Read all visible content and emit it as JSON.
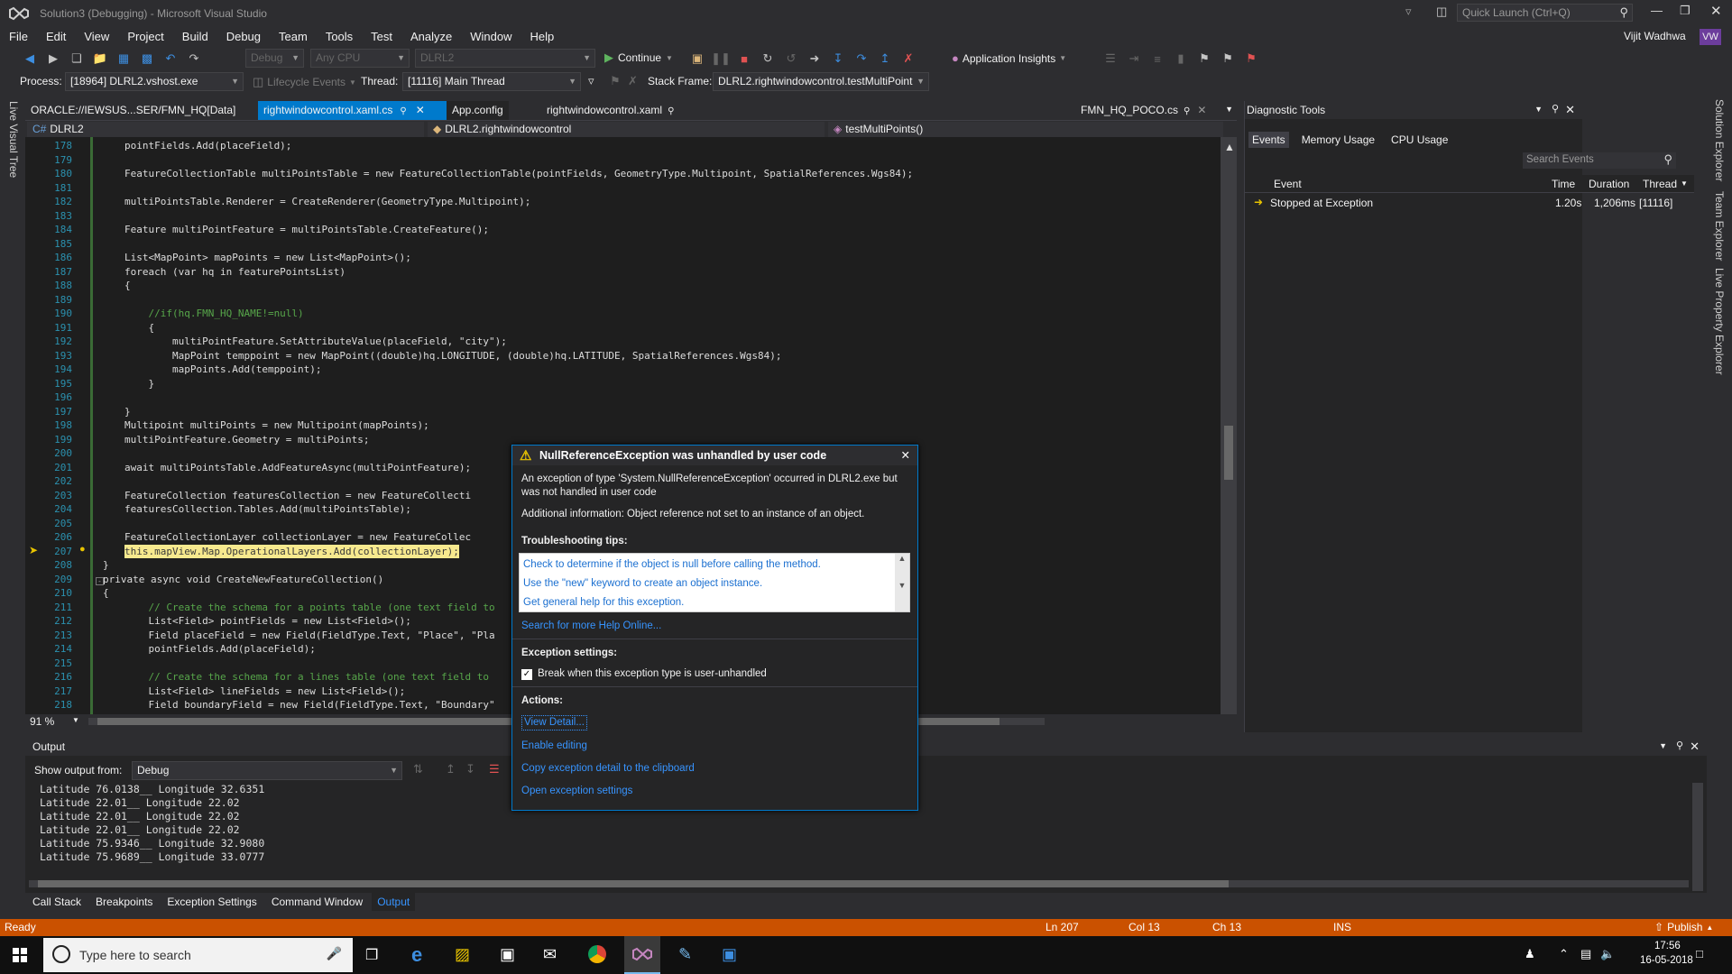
{
  "title": {
    "text": "Solution3 (Debugging) - Microsoft Visual Studio",
    "quick_launch": "Quick Launch (Ctrl+Q)"
  },
  "menu": [
    "File",
    "Edit",
    "View",
    "Project",
    "Build",
    "Debug",
    "Team",
    "Tools",
    "Test",
    "Analyze",
    "Window",
    "Help"
  ],
  "user": {
    "name": "Vijit Wadhwa",
    "initials": "VW"
  },
  "toolbar": {
    "config": "Debug",
    "platform": "Any CPU",
    "project": "DLRL2",
    "continue": "Continue",
    "insights": "Application Insights"
  },
  "debugbar": {
    "process_label": "Process:",
    "process": "[18964] DLRL2.vshost.exe",
    "lifecycle": "Lifecycle Events",
    "thread_label": "Thread:",
    "thread": "[11116] Main Thread",
    "frame_label": "Stack Frame:",
    "frame": "DLRL2.rightwindowcontrol.testMultiPoint"
  },
  "left_vtab": "Live Visual Tree",
  "right_vtabs": [
    "Solution Explorer",
    "Team Explorer",
    "Live Property Explorer"
  ],
  "doc_tabs": {
    "oracle": "ORACLE://IEWSUS...SER/FMN_HQ[Data]",
    "active": "rightwindowcontrol.xaml.cs",
    "appconfig": "App.config",
    "xaml": "rightwindowcontrol.xaml",
    "poco": "FMN_HQ_POCO.cs"
  },
  "nav": {
    "project": "DLRL2",
    "class": "DLRL2.rightwindowcontrol",
    "member": "testMultiPoints()"
  },
  "zoom": "91 %",
  "code_lines": [
    {
      "n": "178",
      "t": "pointFields.Add(placeField);"
    },
    {
      "n": "179",
      "t": ""
    },
    {
      "n": "180",
      "t": "FeatureCollectionTable multiPointsTable = new FeatureCollectionTable(pointFields, GeometryType.Multipoint, SpatialReferences.Wgs84);"
    },
    {
      "n": "181",
      "t": ""
    },
    {
      "n": "182",
      "t": "multiPointsTable.Renderer = CreateRenderer(GeometryType.Multipoint);"
    },
    {
      "n": "183",
      "t": ""
    },
    {
      "n": "184",
      "t": "Feature multiPointFeature = multiPointsTable.CreateFeature();"
    },
    {
      "n": "185",
      "t": ""
    },
    {
      "n": "186",
      "t": "List<MapPoint> mapPoints = new List<MapPoint>();"
    },
    {
      "n": "187",
      "t": "foreach (var hq in featurePointsList)"
    },
    {
      "n": "188",
      "t": "{"
    },
    {
      "n": "189",
      "t": ""
    },
    {
      "n": "190",
      "t": "    //if(hq.FMN_HQ_NAME!=null)"
    },
    {
      "n": "191",
      "t": "    {"
    },
    {
      "n": "192",
      "t": "        multiPointFeature.SetAttributeValue(placeField, \"city\");"
    },
    {
      "n": "193",
      "t": "        MapPoint temppoint = new MapPoint((double)hq.LONGITUDE, (double)hq.LATITUDE, SpatialReferences.Wgs84);"
    },
    {
      "n": "194",
      "t": "        mapPoints.Add(temppoint);"
    },
    {
      "n": "195",
      "t": "    }"
    },
    {
      "n": "196",
      "t": ""
    },
    {
      "n": "197",
      "t": "}"
    },
    {
      "n": "198",
      "t": "Multipoint multiPoints = new Multipoint(mapPoints);"
    },
    {
      "n": "199",
      "t": "multiPointFeature.Geometry = multiPoints;"
    },
    {
      "n": "200",
      "t": ""
    },
    {
      "n": "201",
      "t": "await multiPointsTable.AddFeatureAsync(multiPointFeature);"
    },
    {
      "n": "202",
      "t": ""
    },
    {
      "n": "203",
      "t": "FeatureCollection featuresCollection = new FeatureCollecti"
    },
    {
      "n": "204",
      "t": "featuresCollection.Tables.Add(multiPointsTable);"
    },
    {
      "n": "205",
      "t": ""
    },
    {
      "n": "206",
      "t": "FeatureCollectionLayer collectionLayer = new FeatureCollec"
    },
    {
      "n": "207",
      "t": "this.mapView.Map.OperationalLayers.Add(collectionLayer);"
    },
    {
      "n": "208",
      "t": "}"
    },
    {
      "n": "209",
      "t": "private async void CreateNewFeatureCollection()"
    },
    {
      "n": "210",
      "t": "{"
    },
    {
      "n": "211",
      "t": "    // Create the schema for a points table (one text field to"
    },
    {
      "n": "212",
      "t": "    List<Field> pointFields = new List<Field>();"
    },
    {
      "n": "213",
      "t": "    Field placeField = new Field(FieldType.Text, \"Place\", \"Pla"
    },
    {
      "n": "214",
      "t": "    pointFields.Add(placeField);"
    },
    {
      "n": "215",
      "t": ""
    },
    {
      "n": "216",
      "t": "    // Create the schema for a lines table (one text field to"
    },
    {
      "n": "217",
      "t": "    List<Field> lineFields = new List<Field>();"
    },
    {
      "n": "218",
      "t": "    Field boundaryField = new Field(FieldType.Text, \"Boundary\""
    }
  ],
  "diagnostic": {
    "title": "Diagnostic Tools",
    "tabs": [
      "Events",
      "Memory Usage",
      "CPU Usage"
    ],
    "search": "Search Events",
    "cols": [
      "Event",
      "Time",
      "Duration",
      "Thread"
    ],
    "row": {
      "event": "Stopped at Exception",
      "time": "1.20s",
      "duration": "1,206ms",
      "thread": "[11116]"
    }
  },
  "output": {
    "title": "Output",
    "show_label": "Show output from:",
    "source": "Debug",
    "lines": [
      "Latitude 76.0138__ Longitude 32.6351",
      "Latitude 22.01__ Longitude 22.02",
      "Latitude 22.01__ Longitude 22.02",
      "Latitude 22.01__ Longitude 22.02",
      "Latitude 75.9346__ Longitude 32.9080",
      "Latitude 75.9689__ Longitude 33.0777"
    ]
  },
  "bottom_tabs": [
    "Call Stack",
    "Breakpoints",
    "Exception Settings",
    "Command Window",
    "Output"
  ],
  "status": {
    "ready": "Ready",
    "ln": "Ln 207",
    "col": "Col 13",
    "ch": "Ch 13",
    "ins": "INS",
    "publish": "Publish"
  },
  "exception": {
    "title": "NullReferenceException was unhandled by user code",
    "desc": "An exception of type 'System.NullReferenceException' occurred in DLRL2.exe but was not handled in user code",
    "info": "Additional information: Object reference not set to an instance of an object.",
    "tips_title": "Troubleshooting tips:",
    "tips": [
      "Check to determine if the object is null before calling the method.",
      "Use the \"new\" keyword to create an object instance.",
      "Get general help for this exception."
    ],
    "search_help": "Search for more Help Online...",
    "settings_title": "Exception settings:",
    "break_label": "Break when this exception type is user-unhandled",
    "actions_title": "Actions:",
    "actions": [
      "View Detail...",
      "Enable editing",
      "Copy exception detail to the clipboard",
      "Open exception settings"
    ]
  },
  "taskbar": {
    "search": "Type here to search",
    "time": "17:56",
    "date": "16-05-2018"
  },
  "colors": {
    "accent": "#007acc",
    "status": "#ca5100",
    "highlight": "#f7e98e"
  }
}
